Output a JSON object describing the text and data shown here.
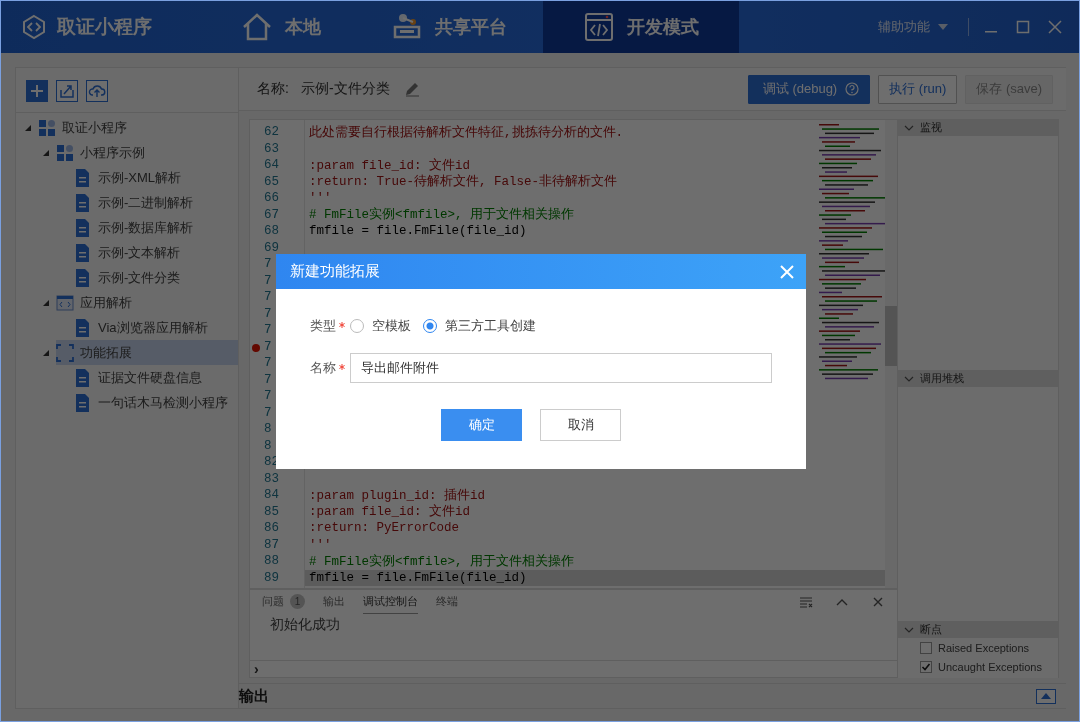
{
  "window": {
    "app_name": "取证小程序",
    "assist_menu": "辅助功能"
  },
  "nav": [
    {
      "label": "本地",
      "selected": false
    },
    {
      "label": "共享平台",
      "selected": false
    },
    {
      "label": "开发模式",
      "selected": true
    }
  ],
  "sidebar": {
    "tree": [
      {
        "label": "取证小程序",
        "kind": "group",
        "expanded": true,
        "selected": false,
        "children": [
          {
            "label": "小程序示例",
            "kind": "group",
            "expanded": true,
            "selected": false,
            "children": [
              {
                "label": "示例-XML解析",
                "kind": "file",
                "selected": false
              },
              {
                "label": "示例-二进制解析",
                "kind": "file",
                "selected": false
              },
              {
                "label": "示例-数据库解析",
                "kind": "file",
                "selected": false
              },
              {
                "label": "示例-文本解析",
                "kind": "file",
                "selected": false
              },
              {
                "label": "示例-文件分类",
                "kind": "file",
                "selected": false
              }
            ]
          },
          {
            "label": "应用解析",
            "kind": "app",
            "expanded": true,
            "selected": false,
            "children": [
              {
                "label": "Via浏览器应用解析",
                "kind": "file",
                "selected": false
              }
            ]
          },
          {
            "label": "功能拓展",
            "kind": "extension",
            "expanded": true,
            "selected": true,
            "children": [
              {
                "label": "证据文件硬盘信息",
                "kind": "file",
                "selected": false
              },
              {
                "label": "一句话木马检测小程序",
                "kind": "file",
                "selected": false
              }
            ]
          }
        ]
      }
    ]
  },
  "editor": {
    "name_label": "名称:",
    "name_value": "示例-文件分类",
    "buttons": [
      {
        "label": "调试 (debug)",
        "kind": "primary",
        "disabled": false
      },
      {
        "label": "执行 (run)",
        "kind": "outline",
        "disabled": false
      },
      {
        "label": "保存 (save)",
        "kind": "outline",
        "disabled": true
      }
    ],
    "lines": [
      {
        "number": "62",
        "kind": "doc",
        "text": "此处需要自行根据待解析文件特征,挑拣待分析的文件.",
        "breakpoint": false,
        "highlighted": false
      },
      {
        "number": "63",
        "kind": "code",
        "breakpoint": false,
        "highlighted": false
      },
      {
        "number": "64",
        "kind": "doc",
        "text": ":param file_id: 文件id",
        "breakpoint": false,
        "highlighted": false
      },
      {
        "number": "65",
        "kind": "doc",
        "text": ":return: True-待解析文件, False-非待解析文件",
        "breakpoint": false,
        "highlighted": false
      },
      {
        "number": "66",
        "kind": "doc",
        "text": "'''",
        "breakpoint": false,
        "highlighted": false
      },
      {
        "number": "67",
        "kind": "comment",
        "text": "# FmFile实例<fmfile>, 用于文件相关操作",
        "breakpoint": false,
        "highlighted": false
      },
      {
        "number": "68",
        "kind": "code",
        "text": "fmfile = file.FmFile(file_id)",
        "breakpoint": false,
        "highlighted": false
      },
      {
        "number": "69",
        "kind": "comment",
        "breakpoint": false,
        "highlighted": false
      },
      {
        "number": "7",
        "kind": "code",
        "breakpoint": false,
        "highlighted": false
      },
      {
        "number": "7",
        "kind": "code",
        "breakpoint": false,
        "highlighted": false
      },
      {
        "number": "7",
        "kind": "code",
        "breakpoint": false,
        "highlighted": false
      },
      {
        "number": "7",
        "kind": "code",
        "breakpoint": false,
        "highlighted": false
      },
      {
        "number": "7",
        "kind": "code",
        "breakpoint": false,
        "highlighted": false
      },
      {
        "number": "7",
        "kind": "code",
        "breakpoint": true,
        "highlighted": false
      },
      {
        "number": "7",
        "kind": "code",
        "breakpoint": false,
        "highlighted": false
      },
      {
        "number": "7",
        "kind": "code",
        "breakpoint": false,
        "highlighted": false
      },
      {
        "number": "7",
        "kind": "code",
        "breakpoint": false,
        "highlighted": false
      },
      {
        "number": "7",
        "kind": "code",
        "breakpoint": false,
        "highlighted": false
      },
      {
        "number": "8",
        "kind": "code",
        "breakpoint": false,
        "highlighted": false
      },
      {
        "number": "8",
        "kind": "code",
        "breakpoint": false,
        "highlighted": false
      },
      {
        "number": "82",
        "kind": "doc",
        "breakpoint": false,
        "highlighted": false
      },
      {
        "number": "83",
        "kind": "code",
        "breakpoint": false,
        "highlighted": false
      },
      {
        "number": "84",
        "kind": "doc",
        "text": ":param plugin_id: 插件id",
        "breakpoint": false,
        "highlighted": false
      },
      {
        "number": "85",
        "kind": "doc",
        "text": ":param file_id: 文件id",
        "breakpoint": false,
        "highlighted": false
      },
      {
        "number": "86",
        "kind": "doc",
        "text": ":return: PyErrorCode",
        "breakpoint": false,
        "highlighted": false
      },
      {
        "number": "87",
        "kind": "doc",
        "text": "'''",
        "breakpoint": false,
        "highlighted": false
      },
      {
        "number": "88",
        "kind": "comment",
        "text": "# FmFile实例<fmfile>, 用于文件相关操作",
        "breakpoint": false,
        "highlighted": false
      },
      {
        "number": "89",
        "kind": "code",
        "text": "fmfile = file.FmFile(file_id)",
        "breakpoint": false,
        "highlighted": true
      }
    ]
  },
  "panel": {
    "tabs": [
      {
        "label": "问题",
        "badge": "1",
        "selected": false
      },
      {
        "label": "输出",
        "selected": false
      },
      {
        "label": "调试控制台",
        "selected": true
      },
      {
        "label": "终端",
        "selected": false
      }
    ],
    "console_text": "初始化成功",
    "prompt": "›"
  },
  "debug": {
    "sections": [
      {
        "title": "监视"
      },
      {
        "title": "调用堆栈"
      },
      {
        "title": "断点",
        "items": [
          {
            "label": "Raised Exceptions",
            "checked": false
          },
          {
            "label": "Uncaught Exceptions",
            "checked": true
          }
        ]
      }
    ]
  },
  "output_bar": {
    "title": "输出"
  },
  "dialog": {
    "title": "新建功能拓展",
    "type_field": {
      "label": "类型",
      "required": true,
      "options": [
        {
          "label": "空模板",
          "selected": false
        },
        {
          "label": "第三方工具创建",
          "selected": true
        }
      ]
    },
    "name_field": {
      "label": "名称",
      "required": true,
      "value": "导出邮件附件"
    },
    "buttons": [
      {
        "label": "确定",
        "kind": "primary"
      },
      {
        "label": "取消",
        "kind": "default"
      }
    ]
  }
}
